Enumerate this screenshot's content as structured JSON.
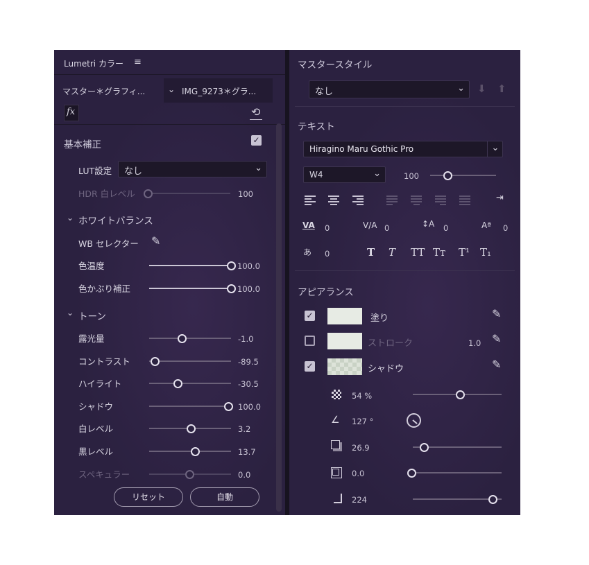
{
  "lumetri": {
    "title": "Lumetri カラー",
    "menu_icon": "hamburger-menu-icon",
    "master_tab": "マスター＊グラフィ...",
    "clip_tab": "IMG_9273＊グラ...",
    "fx_label": "fx",
    "reset_icon": "reset-arrow-icon",
    "basic_title": "基本補正",
    "basic_enabled": true,
    "lut_label": "LUT設定",
    "lut_value": "なし",
    "hdr_label": "HDR 白レベル",
    "hdr_value": "100",
    "wb_section": "ホワイトバランス",
    "wb_selector": "WB セレクター",
    "temperature_label": "色温度",
    "temperature_value": "100.0",
    "tint_label": "色かぶり補正",
    "tint_value": "100.0",
    "tone_section": "トーン",
    "sliders": [
      {
        "label": "露光量",
        "value": "-1.0",
        "pos": 0.4
      },
      {
        "label": "コントラスト",
        "value": "-89.5",
        "pos": 0.05
      },
      {
        "label": "ハイライト",
        "value": "-30.5",
        "pos": 0.35
      },
      {
        "label": "シャドウ",
        "value": "100.0",
        "pos": 1.0
      },
      {
        "label": "白レベル",
        "value": "3.2",
        "pos": 0.52
      },
      {
        "label": "黒レベル",
        "value": "13.7",
        "pos": 0.57
      },
      {
        "label": "スペキュラー",
        "value": "0.0",
        "pos": 0.5
      }
    ],
    "reset_button": "リセット",
    "auto_button": "自動"
  },
  "master_style": {
    "title": "マスタースタイル",
    "value": "なし"
  },
  "text": {
    "title": "テキスト",
    "font": "Hiragino Maru Gothic Pro",
    "weight": "W4",
    "size": "100",
    "kerning": "0",
    "tracking": "0",
    "leading": "0",
    "baseline": "0",
    "tsume": "0",
    "styles": [
      "T",
      "T",
      "TT",
      "Tт",
      "T¹",
      "T₁"
    ]
  },
  "appearance": {
    "title": "アピアランス",
    "fill_label": "塗り",
    "fill_enabled": true,
    "stroke_label": "ストローク",
    "stroke_enabled": false,
    "stroke_value": "1.0",
    "shadow_label": "シャドウ",
    "shadow_enabled": true,
    "opacity": "54 %",
    "angle": "127 °",
    "distance": "26.9",
    "spread": "0.0",
    "blur": "224"
  },
  "colors": {
    "panel_bg": "#2b2140",
    "swatch": "#e7ebe4",
    "accent_text": "#d9d6e2"
  }
}
